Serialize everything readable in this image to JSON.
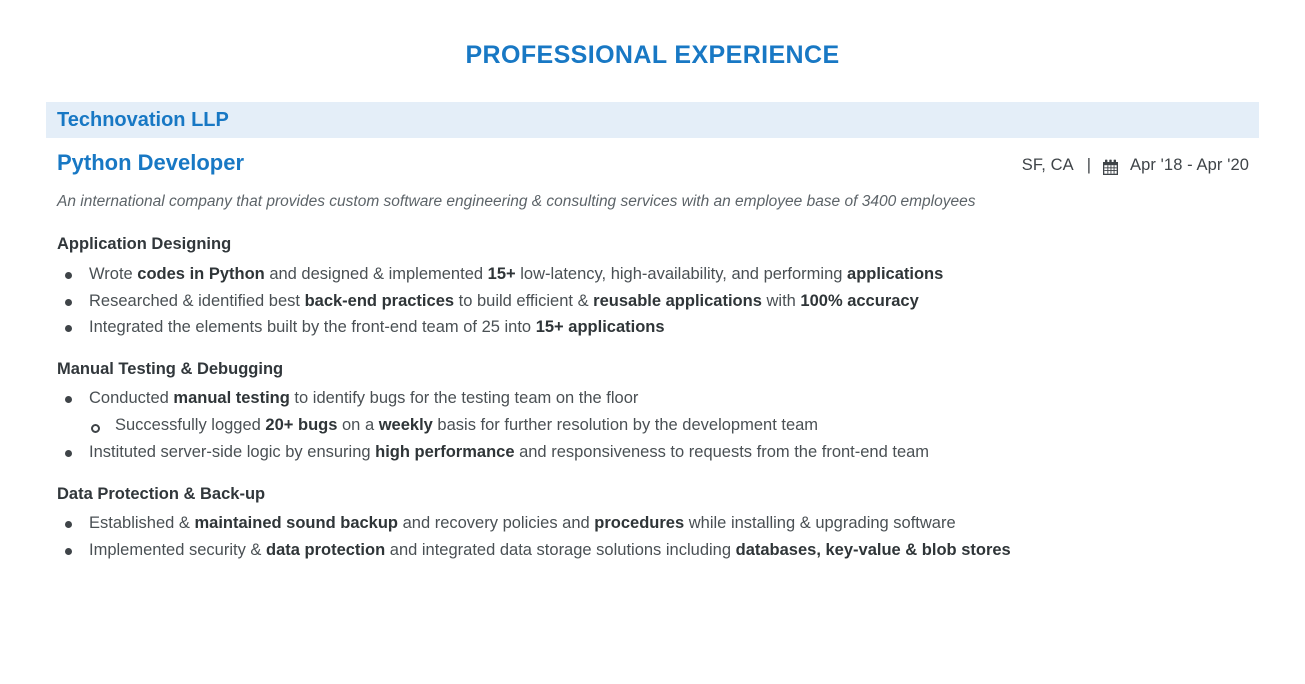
{
  "document": {
    "section_title": "PROFESSIONAL EXPERIENCE",
    "accent_color": "#1878c4",
    "band_color": "#e4eef8",
    "body_color": "#4a5054"
  },
  "experience": {
    "company": "Technovation LLP",
    "role": "Python Developer",
    "location": "SF, CA",
    "separator": "|",
    "calendar_icon": "calendar-icon",
    "dates": "Apr '18 -  Apr '20",
    "description": "An international company that provides custom software engineering & consulting services with an employee base of 3400 employees",
    "sections": [
      {
        "heading": "Application Designing",
        "bullets": [
          {
            "level": 1,
            "parts": [
              {
                "text": "Wrote ",
                "bold": false
              },
              {
                "text": "codes in Python",
                "bold": true
              },
              {
                "text": " and designed & implemented ",
                "bold": false
              },
              {
                "text": "15+",
                "bold": true
              },
              {
                "text": " low-latency, high-availability, and performing ",
                "bold": false
              },
              {
                "text": "applications",
                "bold": true
              }
            ]
          },
          {
            "level": 1,
            "parts": [
              {
                "text": "Researched & identified best ",
                "bold": false
              },
              {
                "text": "back-end practices",
                "bold": true
              },
              {
                "text": " to build efficient & ",
                "bold": false
              },
              {
                "text": "reusable applications",
                "bold": true
              },
              {
                "text": " with ",
                "bold": false
              },
              {
                "text": "100% accuracy",
                "bold": true
              }
            ]
          },
          {
            "level": 1,
            "parts": [
              {
                "text": "Integrated the elements built by the front-end team of 25 into ",
                "bold": false
              },
              {
                "text": "15+ applications",
                "bold": true
              }
            ]
          }
        ]
      },
      {
        "heading": "Manual Testing & Debugging",
        "bullets": [
          {
            "level": 1,
            "parts": [
              {
                "text": "Conducted ",
                "bold": false
              },
              {
                "text": "manual testing",
                "bold": true
              },
              {
                "text": " to identify bugs for the testing team on the floor",
                "bold": false
              }
            ]
          },
          {
            "level": 2,
            "parts": [
              {
                "text": "Successfully logged ",
                "bold": false
              },
              {
                "text": "20+ bugs",
                "bold": true
              },
              {
                "text": " on a ",
                "bold": false
              },
              {
                "text": "weekly",
                "bold": true
              },
              {
                "text": " basis for further resolution by the development team",
                "bold": false
              }
            ]
          },
          {
            "level": 1,
            "parts": [
              {
                "text": "Instituted server-side logic by ensuring ",
                "bold": false
              },
              {
                "text": "high performance",
                "bold": true
              },
              {
                "text": " and responsiveness to requests from the front-end team",
                "bold": false
              }
            ]
          }
        ]
      },
      {
        "heading": "Data Protection & Back-up",
        "bullets": [
          {
            "level": 1,
            "parts": [
              {
                "text": "Established & ",
                "bold": false
              },
              {
                "text": "maintained sound backup",
                "bold": true
              },
              {
                "text": " and recovery policies and ",
                "bold": false
              },
              {
                "text": "procedures",
                "bold": true
              },
              {
                "text": " while installing & upgrading software",
                "bold": false
              }
            ]
          },
          {
            "level": 1,
            "parts": [
              {
                "text": "Implemented security & ",
                "bold": false
              },
              {
                "text": "data protection",
                "bold": true
              },
              {
                "text": " and integrated data storage solutions including ",
                "bold": false
              },
              {
                "text": "databases, key-value & blob stores",
                "bold": true
              }
            ]
          }
        ]
      }
    ]
  }
}
